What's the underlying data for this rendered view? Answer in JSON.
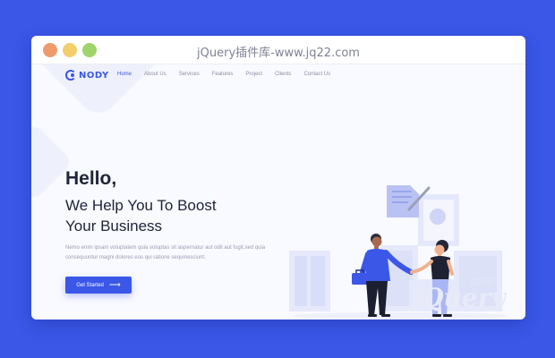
{
  "window": {
    "title": "jQuery插件库-www.jq22.com"
  },
  "nav": {
    "logo": "NODY",
    "items": [
      {
        "label": "Home",
        "active": true
      },
      {
        "label": "About Us",
        "active": false
      },
      {
        "label": "Services",
        "active": false
      },
      {
        "label": "Features",
        "active": false
      },
      {
        "label": "Project",
        "active": false
      },
      {
        "label": "Clients",
        "active": false
      },
      {
        "label": "Contact Us",
        "active": false
      }
    ]
  },
  "hero": {
    "greeting": "Hello,",
    "headline_line1": "We Help You To Boost",
    "headline_line2": "Your Business",
    "description": "Nemo enim ipsam voluptatem quia voluptas sit aspernatur aut odit aut fugit,sed quia consequuntur magni dolores eos qui ratione sequinesciunt.",
    "cta_label": "Get Started",
    "cta_arrow": "⟶"
  },
  "watermark": {
    "text": "jQuery",
    "tag": "插件库"
  },
  "colors": {
    "accent": "#3a57e8",
    "background": "#3a57e8",
    "heading": "#20253a",
    "muted": "#9a9db0"
  },
  "icons": [
    "logo-icon",
    "arrow-right-icon",
    "briefcase-icon"
  ]
}
